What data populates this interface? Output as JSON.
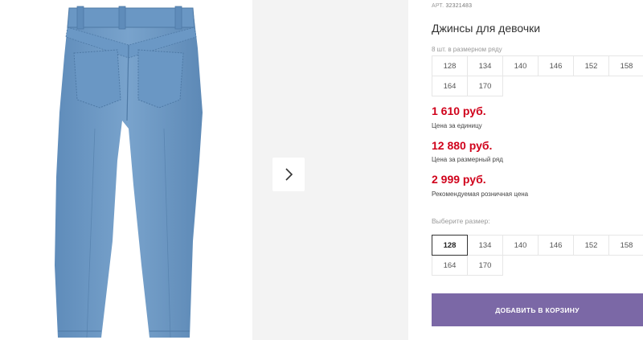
{
  "gallery": {
    "product_image": "jeans-back-view",
    "next_icon": "chevron-right-icon"
  },
  "product": {
    "article_prefix": "АРТ.",
    "article_number": "32321483",
    "title": "Джинсы для девочки",
    "pack_label": "8 шт. в размерном ряду",
    "pack_sizes": [
      "128",
      "134",
      "140",
      "146",
      "152",
      "158",
      "164",
      "170"
    ]
  },
  "prices": [
    {
      "value": "1 610 руб.",
      "note": "Цена за единицу"
    },
    {
      "value": "12 880 руб.",
      "note": "Цена за размерный ряд"
    },
    {
      "value": "2 999 руб.",
      "note": "Рекомендуемая розничная цена"
    }
  ],
  "size_select": {
    "label": "Выберите размер:",
    "sizes": [
      "128",
      "134",
      "140",
      "146",
      "152",
      "158",
      "164",
      "170"
    ],
    "selected": "128"
  },
  "cart": {
    "label": "ДОБАВИТЬ В КОРЗИНУ"
  },
  "colors": {
    "price": "#d0021b",
    "button": "#7b68a6",
    "denim": "#6e9bc6",
    "thumb_panel": "#f3f3f3"
  }
}
